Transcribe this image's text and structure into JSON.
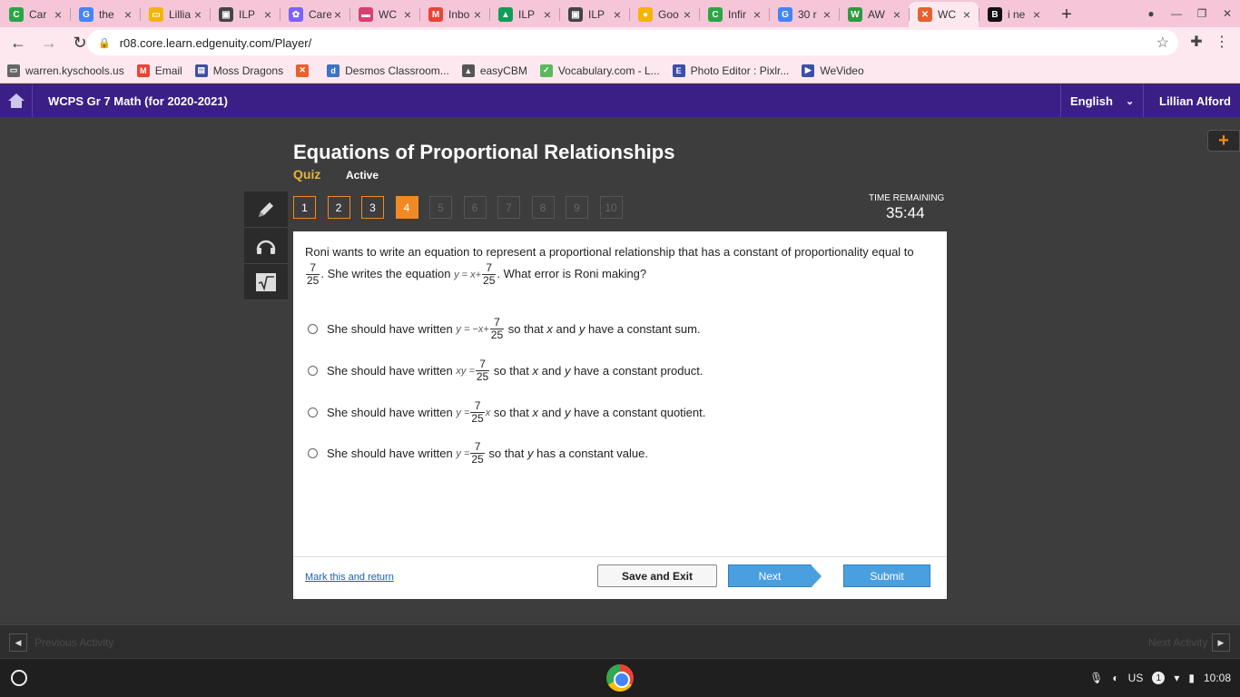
{
  "tabs": [
    {
      "label": "Car",
      "icon": "C",
      "color": "#28a745"
    },
    {
      "label": "the",
      "icon": "G",
      "color": "#4285f4"
    },
    {
      "label": "Lillia",
      "icon": "▭",
      "color": "#f4b400"
    },
    {
      "label": "ILP",
      "icon": "▣",
      "color": "#444444"
    },
    {
      "label": "Care",
      "icon": "✿",
      "color": "#7b61ff"
    },
    {
      "label": "WC",
      "icon": "▬",
      "color": "#d93f6f"
    },
    {
      "label": "Inbo",
      "icon": "M",
      "color": "#ea4335"
    },
    {
      "label": "ILP",
      "icon": "▲",
      "color": "#0f9d58"
    },
    {
      "label": "ILP",
      "icon": "▣",
      "color": "#444444"
    },
    {
      "label": "Goo",
      "icon": "●",
      "color": "#f4b400"
    },
    {
      "label": "Infir",
      "icon": "C",
      "color": "#28a745"
    },
    {
      "label": "30 r",
      "icon": "G",
      "color": "#4285f4"
    },
    {
      "label": "AW",
      "icon": "W",
      "color": "#2e9b3f"
    },
    {
      "label": "WC",
      "icon": "✕",
      "color": "#e8602c"
    },
    {
      "label": "i ne",
      "icon": "B",
      "color": "#111111"
    }
  ],
  "new_tab_symbol": "+",
  "address": {
    "url": "r08.core.learn.edgenuity.com/Player/"
  },
  "bookmarks": [
    {
      "label": "warren.kyschools.us",
      "icon": "▭",
      "color": "#666666"
    },
    {
      "label": "Email",
      "icon": "M",
      "color": "#ea4335"
    },
    {
      "label": "Moss Dragons",
      "icon": "▤",
      "color": "#3b4fa8"
    },
    {
      "label": "",
      "icon": "✕",
      "color": "#e8602c"
    },
    {
      "label": "Desmos Classroom...",
      "icon": "d",
      "color": "#3b73c5"
    },
    {
      "label": "easyCBM",
      "icon": "▲",
      "color": "#555555"
    },
    {
      "label": "Vocabulary.com - L...",
      "icon": "✓",
      "color": "#5cb85c"
    },
    {
      "label": "Photo Editor : Pixlr...",
      "icon": "E",
      "color": "#3b4fa8"
    },
    {
      "label": "WeVideo",
      "icon": "▶",
      "color": "#3b4fa8"
    }
  ],
  "app": {
    "course": "WCPS Gr 7 Math (for 2020-2021)",
    "language": "English",
    "user": "Lillian Alford"
  },
  "activity": {
    "title": "Equations of Proportional Relationships",
    "type": "Quiz",
    "status": "Active"
  },
  "questions": [
    {
      "n": "1",
      "state": "done"
    },
    {
      "n": "2",
      "state": "done"
    },
    {
      "n": "3",
      "state": "done"
    },
    {
      "n": "4",
      "state": "current"
    },
    {
      "n": "5",
      "state": "locked"
    },
    {
      "n": "6",
      "state": "locked"
    },
    {
      "n": "7",
      "state": "locked"
    },
    {
      "n": "8",
      "state": "locked"
    },
    {
      "n": "9",
      "state": "locked"
    },
    {
      "n": "10",
      "state": "locked"
    }
  ],
  "timer": {
    "label": "TIME REMAINING",
    "value": "35:44"
  },
  "question": {
    "text_1": "Roni wants to write an equation to represent a proportional relationship that has a constant of proportionality equal to",
    "text_2": ". She writes the equation",
    "text_3": ". What error is Roni making?",
    "frac_num": "7",
    "frac_den": "25",
    "eq_lhs": "y = x+"
  },
  "choices": [
    {
      "pre": "She should have written",
      "math": "y = −x+",
      "frac_num": "7",
      "frac_den": "25",
      "math_after": "",
      "post_1": "so that",
      "var_a": "x",
      "mid": "and",
      "var_b": "y",
      "post_2": "have a constant sum."
    },
    {
      "pre": "She should have written",
      "math": "xy =",
      "frac_num": "7",
      "frac_den": "25",
      "math_after": "",
      "post_1": "so that",
      "var_a": "x",
      "mid": "and",
      "var_b": "y",
      "post_2": "have a constant product."
    },
    {
      "pre": "She should have written",
      "math": "y =",
      "frac_num": "7",
      "frac_den": "25",
      "math_after": "x",
      "post_1": "so that",
      "var_a": "x",
      "mid": "and",
      "var_b": "y",
      "post_2": "have a constant quotient."
    },
    {
      "pre": "She should have written",
      "math": "y =",
      "frac_num": "7",
      "frac_den": "25",
      "math_after": "",
      "post_1": "so that",
      "var_a": "",
      "mid": "",
      "var_b": "y",
      "post_2": "has a constant value."
    }
  ],
  "footer": {
    "mark": "Mark this and return",
    "save": "Save and Exit",
    "next": "Next",
    "submit": "Submit"
  },
  "activity_nav": {
    "prev": "Previous Activity",
    "next": "Next Activity"
  },
  "tray": {
    "lang": "US",
    "badge": "1",
    "time": "10:08"
  }
}
